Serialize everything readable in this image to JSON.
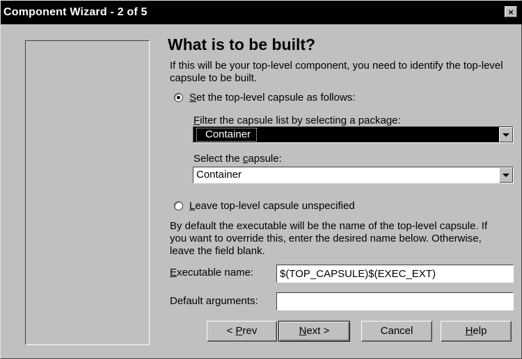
{
  "window": {
    "title": "Component Wizard -  2 of 5",
    "close_symbol": "×"
  },
  "page": {
    "heading": "What is to be built?",
    "intro": "If this will be your top-level component, you need to identify the top-level capsule to be built."
  },
  "option_set": {
    "label_prefix": "",
    "label_mnemonic": "S",
    "label_rest": "et the top-level capsule as follows:",
    "checked": true
  },
  "filter": {
    "label_mnemonic": "F",
    "label_rest": "ilter the capsule list by selecting a package:",
    "value": "Container"
  },
  "capsule": {
    "label_prefix": "Select the ",
    "label_mnemonic": "c",
    "label_rest": "apsule:",
    "value": "Container"
  },
  "option_leave": {
    "label_mnemonic": "L",
    "label_rest": "eave top-level capsule unspecified",
    "checked": false
  },
  "exec_info": "By default the executable will be the name of the top-level capsule.  If you want to override this, enter the desired name below.  Otherwise, leave the field blank.",
  "executable": {
    "label_mnemonic": "E",
    "label_rest": "xecutable name:",
    "value": "$(TOP_CAPSULE)$(EXEC_EXT)"
  },
  "arguments": {
    "label": "Default arguments:",
    "value": ""
  },
  "buttons": {
    "prev_prefix": "< ",
    "prev_mnemonic": "P",
    "prev_rest": "rev",
    "next_mnemonic": "N",
    "next_rest": "ext >",
    "cancel": "Cancel",
    "help_mnemonic": "H",
    "help_rest": "elp"
  },
  "icons": {
    "close": "close-icon",
    "dropdown": "chevron-down-icon"
  }
}
